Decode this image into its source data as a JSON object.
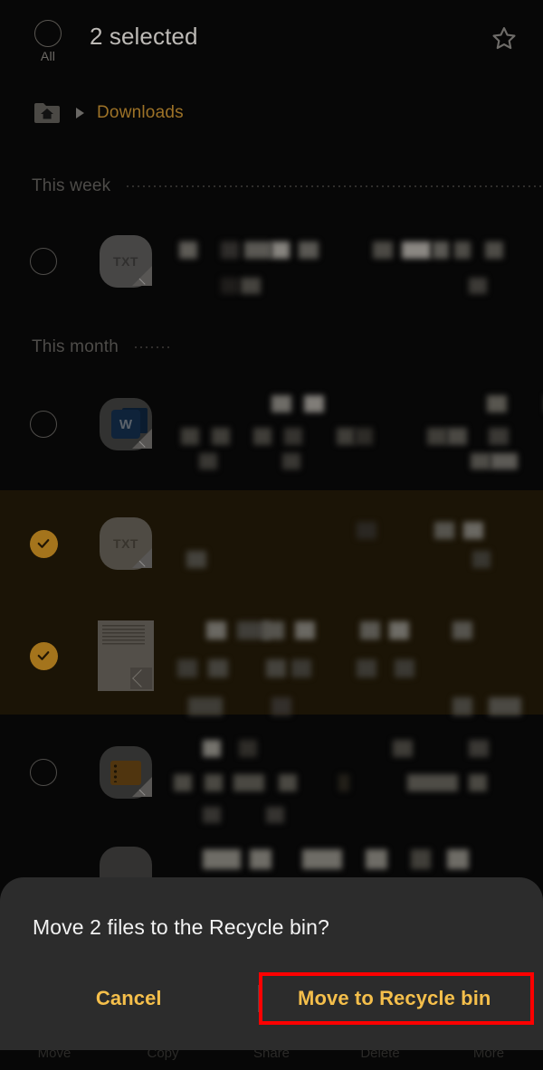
{
  "header": {
    "select_all_label": "All",
    "select_all_icon": "circle-unchecked-icon",
    "title": "2 selected",
    "favorite_icon": "star-outline-icon"
  },
  "breadcrumb": {
    "home_icon": "folder-home-icon",
    "arrow_icon": "triangle-right-icon",
    "current": "Downloads"
  },
  "sections": [
    {
      "label": "This week"
    },
    {
      "label": "This month"
    }
  ],
  "rows": [
    {
      "name": "file-row-1",
      "icon": "txt-file-icon",
      "icon_label": "TXT",
      "selected": false,
      "check_icon": "circle-unchecked-icon"
    },
    {
      "name": "file-row-2",
      "icon": "word-document-icon",
      "icon_label": "W",
      "selected": false,
      "check_icon": "circle-unchecked-icon"
    },
    {
      "name": "file-row-3",
      "icon": "txt-file-icon",
      "icon_label": "TXT",
      "selected": true,
      "check_icon": "circle-checked-icon"
    },
    {
      "name": "file-row-4",
      "icon": "document-thumbnail-icon",
      "icon_label": "",
      "selected": true,
      "check_icon": "circle-checked-icon"
    },
    {
      "name": "file-row-5",
      "icon": "archive-folder-icon",
      "icon_label": "",
      "selected": false,
      "check_icon": "circle-unchecked-icon"
    }
  ],
  "toolbar": {
    "items": [
      {
        "label": "Move"
      },
      {
        "label": "Copy"
      },
      {
        "label": "Share"
      },
      {
        "label": "Delete"
      },
      {
        "label": "More"
      }
    ]
  },
  "dialog": {
    "title": "Move 2 files to the Recycle bin?",
    "cancel_label": "Cancel",
    "confirm_label": "Move to Recycle bin"
  },
  "colors": {
    "accent_amber": "#f5bf4b",
    "breadcrumb_amber": "#9d7227",
    "selected_check": "#a4741c",
    "selected_row_bg": "#1b1406",
    "highlight_box": "#ff0000",
    "dialog_bg": "#2c2c2c",
    "page_bg": "#070707"
  }
}
